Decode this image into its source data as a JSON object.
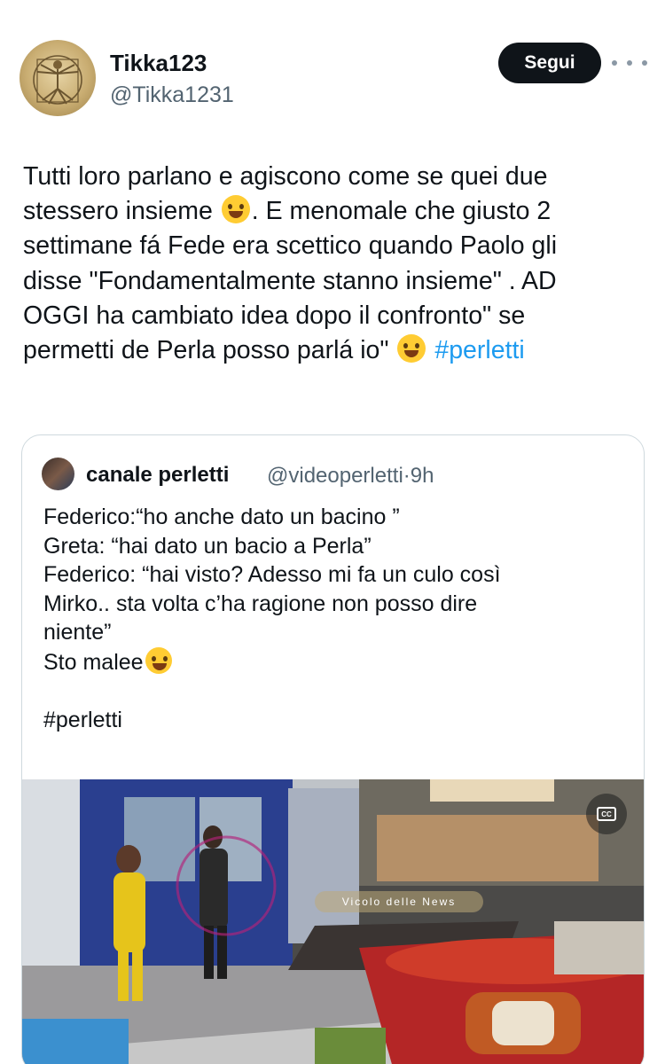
{
  "author": {
    "name": "Tikka123",
    "handle": "@Tikka1231"
  },
  "follow_label": "Segui",
  "tweet": {
    "lines": [
      "Tutti loro parlano e agiscono come se quei due",
      "stessero insieme",
      ". E menomale che giusto 2",
      "settimane fá Fede era scettico quando Paolo gli",
      "disse \"Fondamentalmente stanno insieme\" . AD",
      "OGGI ha cambiato idea dopo il confronto\" se",
      "permetti de Perla posso parlá io\"",
      "#perletti"
    ],
    "emojis": [
      "rolling-on-floor-laughing",
      "grinning-sweat"
    ]
  },
  "quote": {
    "name": "canale perletti",
    "handle": "@videoperletti",
    "separator": "·",
    "time": "9h",
    "lines": [
      "Federico:“ho anche dato un bacino ”",
      "Greta: “hai dato un bacio a Perla”",
      "Federico: “hai visto? Adesso mi fa un culo così",
      "Mirko.. sta volta c’ha ragione non posso dire",
      "niente”",
      "Sto malee",
      "#perletti"
    ],
    "emoji": "face-with-tears-of-joy"
  },
  "media": {
    "icon": "closed-captions-icon",
    "watermark": "Vicolo delle News"
  },
  "colors": {
    "text": "#0f1419",
    "secondary": "#536471",
    "link": "#1d9bf0",
    "button_bg": "#0f1419",
    "border": "#cfd9de"
  }
}
